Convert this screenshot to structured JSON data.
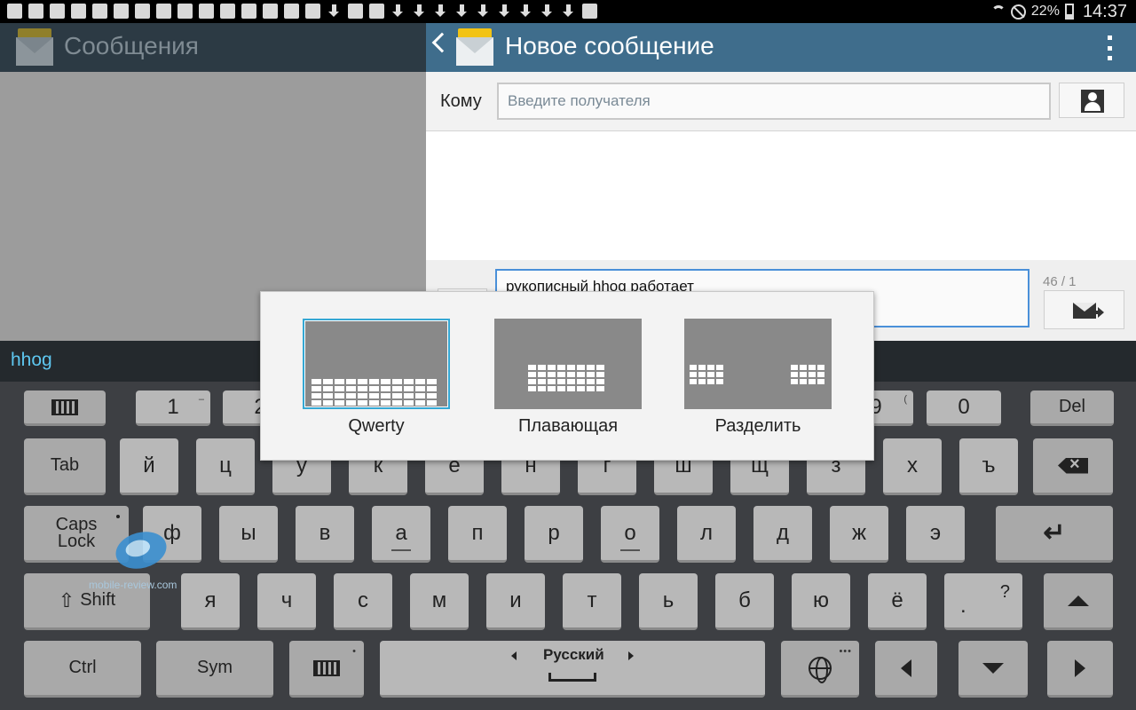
{
  "status_bar": {
    "battery": "22%",
    "time": "14:37"
  },
  "left_pane": {
    "title": "Сообщения"
  },
  "compose": {
    "title": "Новое сообщение",
    "to_label": "Кому",
    "recipient_placeholder": "Введите получателя",
    "message_text": "рукописный hhog работает",
    "counter": "46 / 1"
  },
  "suggestion_bar": {
    "word": "hhog"
  },
  "layout_popup": {
    "options": [
      {
        "label": "Qwerty",
        "selected": true
      },
      {
        "label": "Плавающая",
        "selected": false
      },
      {
        "label": "Разделить",
        "selected": false
      }
    ]
  },
  "keyboard": {
    "row_numbers": {
      "k1": "1",
      "k1_sub": "–",
      "k2": "2",
      "k9": "9",
      "k9_sub": "(",
      "k0": "0",
      "del": "Del"
    },
    "row1": [
      "й",
      "ц",
      "у",
      "к",
      "е",
      "н",
      "г",
      "ш",
      "щ",
      "з",
      "х",
      "ъ"
    ],
    "row2": [
      "ф",
      "ы",
      "в",
      "а",
      "п",
      "р",
      "о",
      "л",
      "д",
      "ж",
      "э"
    ],
    "row3": [
      "я",
      "ч",
      "с",
      "м",
      "и",
      "т",
      "ь",
      "б",
      "ю",
      "ё"
    ],
    "tab": "Tab",
    "caps_line1": "Caps",
    "caps_line2": "Lock",
    "shift": "Shift",
    "punct_top": "?",
    "punct_bottom": ".",
    "ctrl": "Ctrl",
    "sym": "Sym",
    "space_lang": "Русский"
  },
  "watermark": {
    "text": "mobile-review.com"
  },
  "colors": {
    "header_accent": "#3f6d8c",
    "suggestion_text": "#5ec7f0",
    "selection_border": "#35a8d4"
  }
}
